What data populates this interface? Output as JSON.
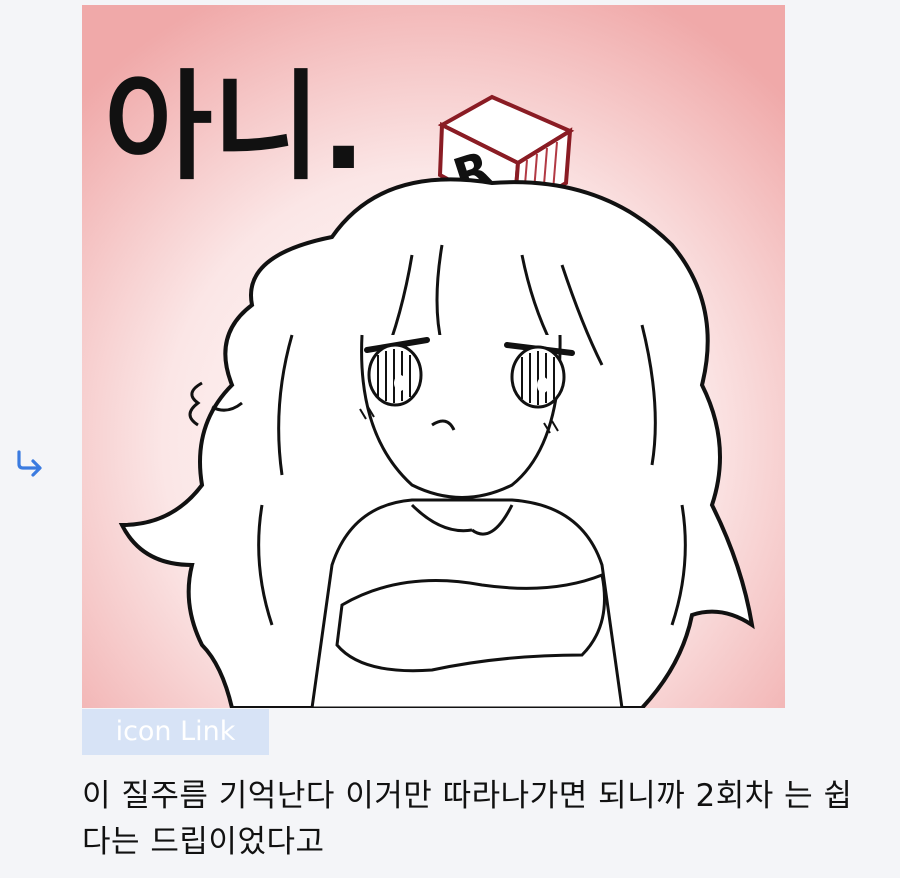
{
  "reply_indicator": {
    "icon": "reply-arrow-icon",
    "color": "#3b7be0"
  },
  "sticker": {
    "caption": "아니.",
    "cube_letter": "R",
    "background_color": "#f2b7b7"
  },
  "icon_link": {
    "label": "icon Link"
  },
  "comment": {
    "text": "이 질주름 기억난다 이거만 따라나가면 되니까 2회차 는 쉽다는 드립이었다고"
  }
}
